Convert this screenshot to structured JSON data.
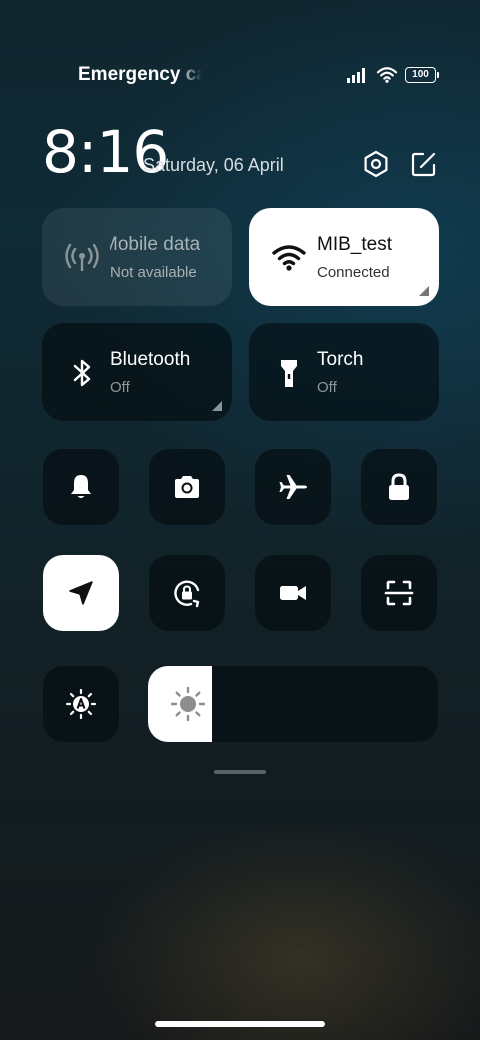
{
  "status_bar": {
    "carrier_text": "Emergency calls only",
    "battery_level": "100"
  },
  "header": {
    "time": "8:16",
    "date": "Saturday, 06 April"
  },
  "tiles": {
    "mobile_data": {
      "title": "Mobile data",
      "status": "Not available",
      "active": false
    },
    "wifi": {
      "title": "MIB_test",
      "status": "Connected",
      "active": true
    },
    "bluetooth": {
      "title": "Bluetooth",
      "status": "Off",
      "active": false
    },
    "torch": {
      "title": "Torch",
      "status": "Off",
      "active": false
    }
  },
  "toggles_row1": [
    "bell-icon",
    "camera-icon",
    "airplane-icon",
    "lock-icon"
  ],
  "toggles_row2": [
    "location-arrow-icon",
    "rotation-lock-icon",
    "video-camera-icon",
    "scan-icon"
  ],
  "location_active": true,
  "brightness_level_percent": 22,
  "colors": {
    "active_tile": "#ffffff",
    "inactive_tile": "#0a1216"
  }
}
